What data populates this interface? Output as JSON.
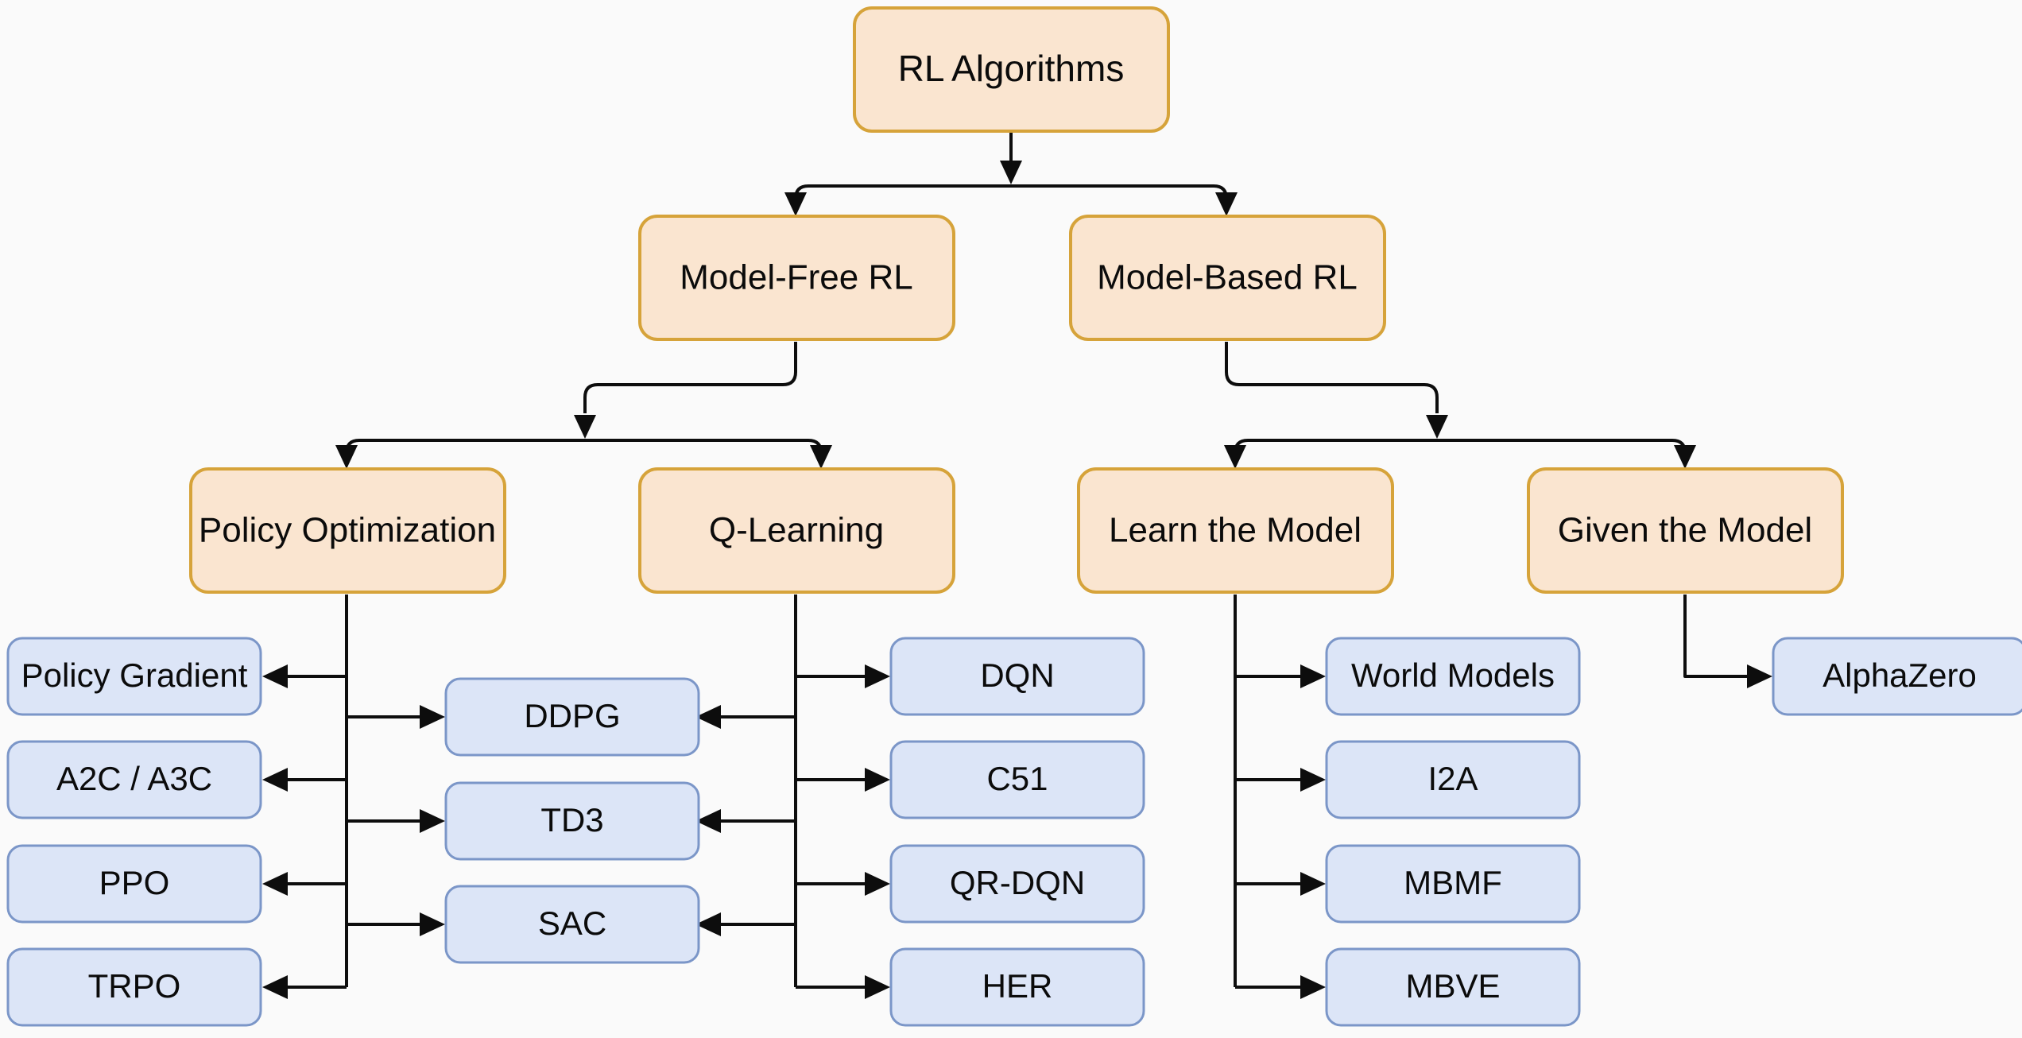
{
  "diagram": {
    "type": "tree-taxonomy",
    "title": "RL Algorithms",
    "background_color": "#fafafa",
    "category_fill": "#fae5d0",
    "category_stroke": "#d6a33a",
    "algorithm_fill": "#dce5f7",
    "algorithm_stroke": "#7b96c8",
    "edge_color": "#0d0d0d"
  },
  "nodes": {
    "root": {
      "label": "RL Algorithms",
      "kind": "category"
    },
    "model_free": {
      "label": "Model-Free RL",
      "kind": "category"
    },
    "model_based": {
      "label": "Model-Based RL",
      "kind": "category"
    },
    "policy_optimization": {
      "label": "Policy Optimization",
      "kind": "category"
    },
    "q_learning": {
      "label": "Q-Learning",
      "kind": "category"
    },
    "learn_the_model": {
      "label": "Learn the Model",
      "kind": "category"
    },
    "given_the_model": {
      "label": "Given the Model",
      "kind": "category"
    },
    "policy_gradient": {
      "label": "Policy Gradient",
      "kind": "algorithm"
    },
    "a2c_a3c": {
      "label": "A2C / A3C",
      "kind": "algorithm"
    },
    "ppo": {
      "label": "PPO",
      "kind": "algorithm"
    },
    "trpo": {
      "label": "TRPO",
      "kind": "algorithm"
    },
    "ddpg": {
      "label": "DDPG",
      "kind": "algorithm"
    },
    "td3": {
      "label": "TD3",
      "kind": "algorithm"
    },
    "sac": {
      "label": "SAC",
      "kind": "algorithm"
    },
    "dqn": {
      "label": "DQN",
      "kind": "algorithm"
    },
    "c51": {
      "label": "C51",
      "kind": "algorithm"
    },
    "qr_dqn": {
      "label": "QR-DQN",
      "kind": "algorithm"
    },
    "her": {
      "label": "HER",
      "kind": "algorithm"
    },
    "world_models": {
      "label": "World Models",
      "kind": "algorithm"
    },
    "i2a": {
      "label": "I2A",
      "kind": "algorithm"
    },
    "mbmf": {
      "label": "MBMF",
      "kind": "algorithm"
    },
    "mbve": {
      "label": "MBVE",
      "kind": "algorithm"
    },
    "alphazero": {
      "label": "AlphaZero",
      "kind": "algorithm"
    }
  },
  "edges": [
    {
      "from": "root",
      "to": "model_free"
    },
    {
      "from": "root",
      "to": "model_based"
    },
    {
      "from": "model_free",
      "to": "policy_optimization"
    },
    {
      "from": "model_free",
      "to": "q_learning"
    },
    {
      "from": "model_based",
      "to": "learn_the_model"
    },
    {
      "from": "model_based",
      "to": "given_the_model"
    },
    {
      "from": "policy_optimization",
      "to": "policy_gradient"
    },
    {
      "from": "policy_optimization",
      "to": "a2c_a3c"
    },
    {
      "from": "policy_optimization",
      "to": "ppo"
    },
    {
      "from": "policy_optimization",
      "to": "trpo"
    },
    {
      "from": "policy_optimization",
      "to": "ddpg"
    },
    {
      "from": "policy_optimization",
      "to": "td3"
    },
    {
      "from": "policy_optimization",
      "to": "sac"
    },
    {
      "from": "q_learning",
      "to": "ddpg"
    },
    {
      "from": "q_learning",
      "to": "td3"
    },
    {
      "from": "q_learning",
      "to": "sac"
    },
    {
      "from": "q_learning",
      "to": "dqn"
    },
    {
      "from": "q_learning",
      "to": "c51"
    },
    {
      "from": "q_learning",
      "to": "qr_dqn"
    },
    {
      "from": "q_learning",
      "to": "her"
    },
    {
      "from": "learn_the_model",
      "to": "world_models"
    },
    {
      "from": "learn_the_model",
      "to": "i2a"
    },
    {
      "from": "learn_the_model",
      "to": "mbmf"
    },
    {
      "from": "learn_the_model",
      "to": "mbve"
    },
    {
      "from": "given_the_model",
      "to": "alphazero"
    }
  ]
}
